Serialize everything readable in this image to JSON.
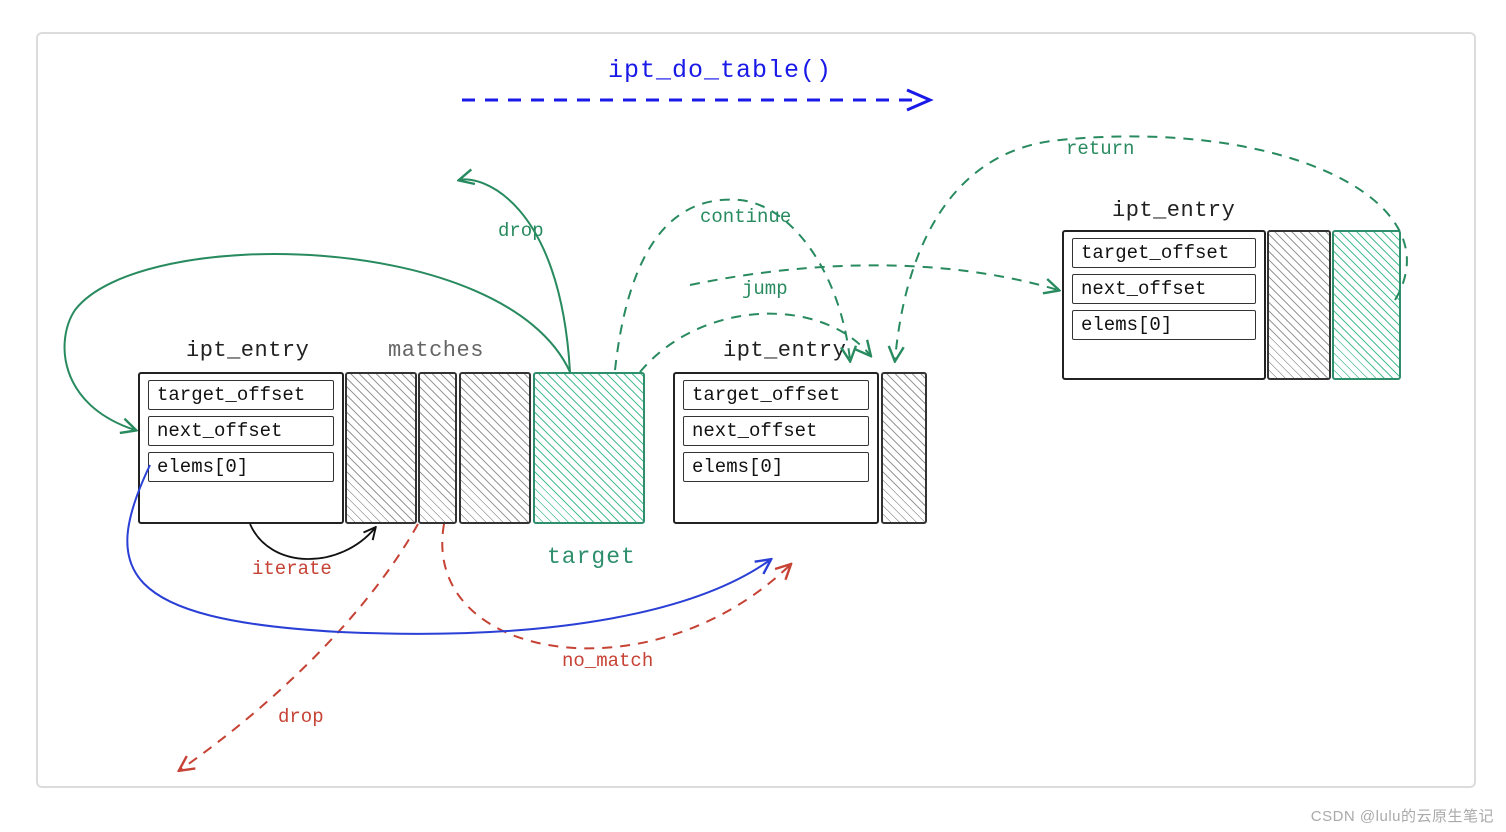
{
  "fn_name": "ipt_do_table()",
  "entry_title": "ipt_entry",
  "section": {
    "matches": "matches",
    "target": "target"
  },
  "fields": {
    "target_offset": "target_offset",
    "next_offset": "next_offset",
    "elems0": "elems[0]"
  },
  "edges": {
    "drop_top": "drop",
    "continue": "continue",
    "jump": "jump",
    "return": "return",
    "iterate": "iterate",
    "no_match": "no_match",
    "drop_bottom": "drop"
  },
  "watermark": "CSDN @lulu的云原生笔记"
}
